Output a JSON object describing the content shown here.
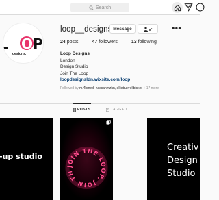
{
  "topnav": {
    "search_placeholder": "Search"
  },
  "profile": {
    "username": "loop__designs",
    "message_label": "Message",
    "stats": {
      "posts_count": "24",
      "posts_label": "posts",
      "followers_count": "47",
      "followers_label": "followers",
      "following_count": "13",
      "following_label": "following"
    },
    "bio": {
      "name": "Loop Designs",
      "line1": "London",
      "line2": "Design Studio",
      "line3": "Join The Loop",
      "link": "loopdesignsldn.wixsite.com/loop"
    },
    "followed_by_prefix": "Followed by",
    "followed_by_names": "m.4hmed, hassanmzkn, elliebu rrellbicker",
    "followed_by_suffix": "+ 17 more",
    "logo_text": "L OOP",
    "logo_sub": "designs."
  },
  "tabs": {
    "posts": "POSTS",
    "tagged": "TAGGED"
  },
  "grid": {
    "tile1_text": "-up studio",
    "tile2_text": "JOIN THE LOOP.",
    "tile3_lines": [
      "Creativ",
      "Design",
      "Studio"
    ]
  },
  "colors": {
    "brand_pink": "#e8336b",
    "link_blue": "#00376b",
    "neon_pink": "#ff2d7a"
  }
}
